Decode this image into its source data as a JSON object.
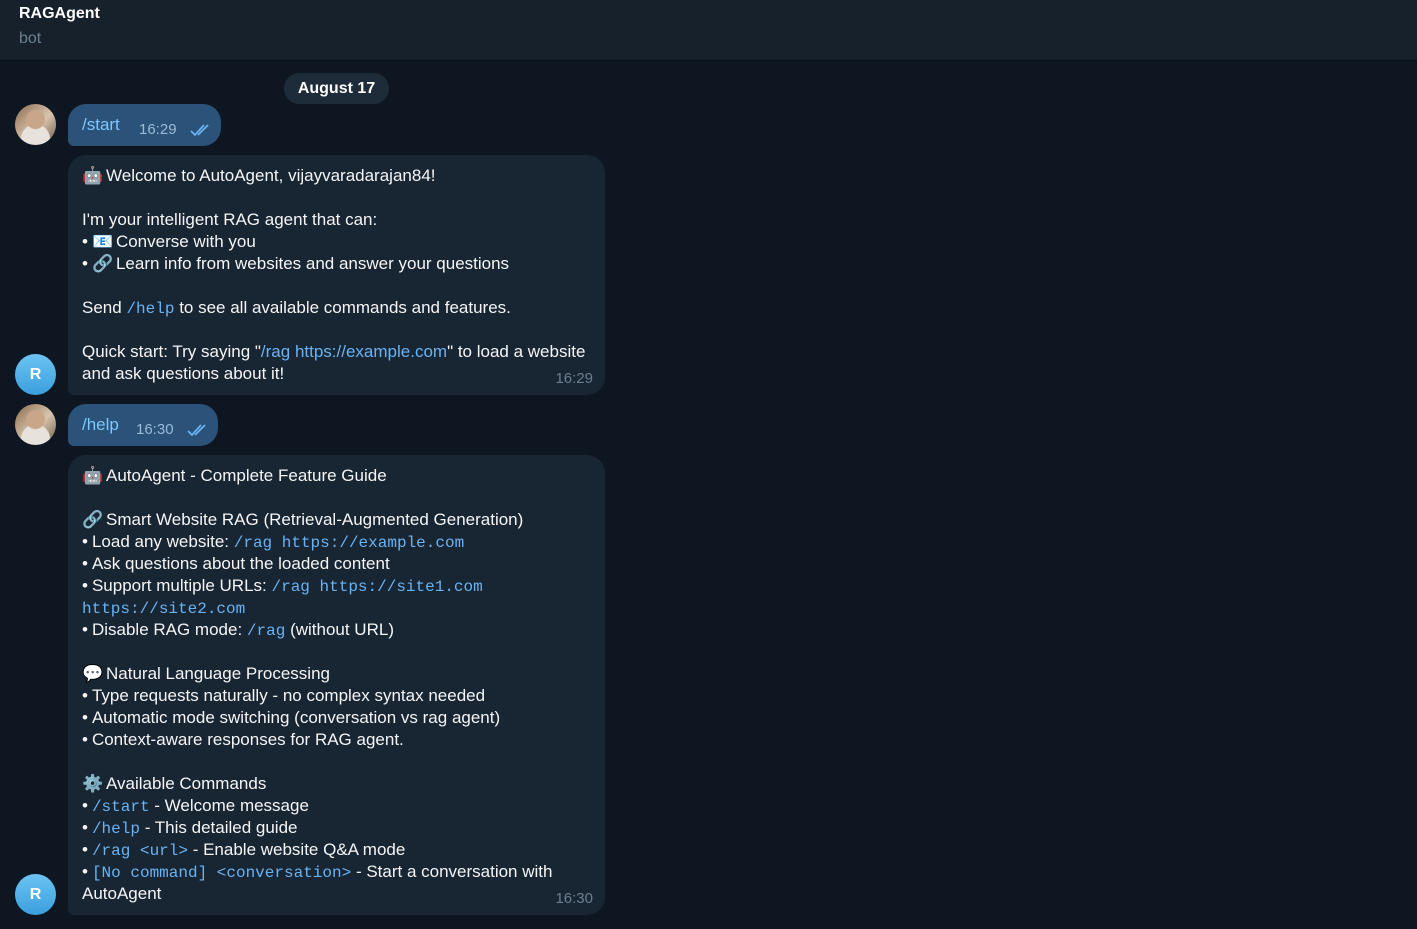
{
  "header": {
    "title": "RAGAgent",
    "subtitle": "bot"
  },
  "date_divider": "August 17",
  "colors": {
    "accent": "#6ab3f3",
    "outgoing_bubble": "#2b5278",
    "incoming_bubble": "#182533"
  },
  "messages": {
    "start_cmd": {
      "text": "/start",
      "time": "16:29"
    },
    "welcome": {
      "robot_icon": "🤖",
      "title": "Welcome to AutoAgent, vijayvaradarajan84!",
      "intro": "I'm your intelligent RAG agent that can:",
      "bullet1_icon": "📧",
      "bullet1": "Converse with you",
      "bullet2_icon": "🔗",
      "bullet2": "Learn info from websites and answer your questions",
      "send_prefix": "Send",
      "send_cmd": "/help",
      "send_suffix": "to see all available commands and features.",
      "quick_prefix": "Quick start: Try saying \"",
      "quick_cmd": "/rag",
      "quick_url": "https://example.com",
      "quick_suffix": "\" to load a website",
      "quick_line2": "and ask questions about it!",
      "time": "16:29"
    },
    "help_cmd": {
      "text": "/help",
      "time": "16:30"
    },
    "guide": {
      "title": "AutoAgent - Complete Feature Guide",
      "s1_title": "Smart Website RAG (Retrieval-Augmented Generation)",
      "s1_b1_label": "Load any website:",
      "s1_b1_code": "/rag https://example.com",
      "s1_b2": "Ask questions about the loaded content",
      "s1_b3_label": "Support multiple URLs:",
      "s1_b3_code1": "/rag https://site1.com",
      "s1_b3_code2": "https://site2.com",
      "s1_b4_label": "Disable RAG mode:",
      "s1_b4_code": "/rag",
      "s1_b4_suffix": "(without URL)",
      "s2_title": "Natural Language Processing",
      "s2_b1": "Type requests naturally - no complex syntax needed",
      "s2_b2": "Automatic mode switching (conversation vs rag agent)",
      "s2_b3": "Context-aware responses for RAG agent.",
      "s3_title": "Available Commands",
      "c1_code": "/start",
      "c1_text": "- Welcome message",
      "c2_code": "/help",
      "c2_text": "- This detailed guide",
      "c3_code": "/rag <url>",
      "c3_text": "- Enable website Q&A mode",
      "c4_code": "[No command] <conversation>",
      "c4_text": "- Start a conversation with",
      "c4_line2": "AutoAgent",
      "time": "16:30"
    }
  },
  "bot_avatar_letter": "R",
  "icons": {
    "robot": "🤖",
    "link": "🔗",
    "speech": "💬",
    "gear": "⚙️",
    "bullet": "•"
  }
}
